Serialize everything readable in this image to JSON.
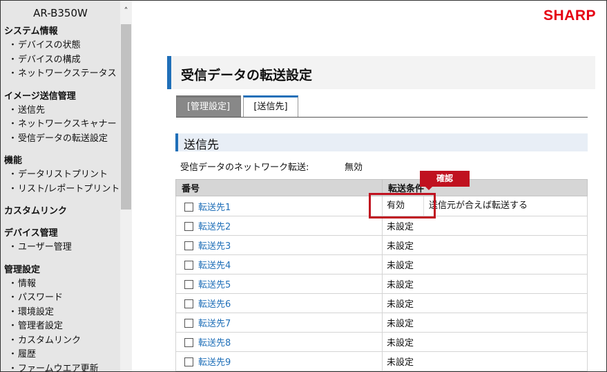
{
  "sidebar": {
    "device_name": "AR-B350W",
    "groups": [
      {
        "heading": "システム情報",
        "items": [
          "デバイスの状態",
          "デバイスの構成",
          "ネットワークステータス"
        ]
      },
      {
        "heading": "イメージ送信管理",
        "items": [
          "送信先",
          "ネットワークスキャナー",
          "受信データの転送設定"
        ]
      },
      {
        "heading": "機能",
        "items": [
          "データリストプリント",
          "リスト/レポートプリント"
        ]
      },
      {
        "heading": "カスタムリンク",
        "items": []
      },
      {
        "heading": "デバイス管理",
        "items": [
          "ユーザー管理"
        ]
      },
      {
        "heading": "管理設定",
        "items": [
          "情報",
          "パスワード",
          "環境設定",
          "管理者設定",
          "カスタムリンク",
          "履歴",
          "ファームウエア更新"
        ]
      }
    ],
    "bullet": "・"
  },
  "header": {
    "logo": "SHARP",
    "page_title": "受信データの転送設定",
    "brand_color": "#e60012",
    "accent_color": "#1f6fb8"
  },
  "tabs": [
    {
      "label": "[管理設定]",
      "active": true
    },
    {
      "label": "[送信先]",
      "active": false
    }
  ],
  "section": {
    "title": "送信先",
    "network_forward_label": "受信データのネットワーク転送:",
    "network_forward_value": "無効"
  },
  "table": {
    "headers": [
      "番号",
      "転送条件"
    ],
    "rows": [
      {
        "name": "転送先1",
        "condition": "有効",
        "detail": "送信元が合えば転送する"
      },
      {
        "name": "転送先2",
        "condition": "未設定"
      },
      {
        "name": "転送先3",
        "condition": "未設定"
      },
      {
        "name": "転送先4",
        "condition": "未設定"
      },
      {
        "name": "転送先5",
        "condition": "未設定"
      },
      {
        "name": "転送先6",
        "condition": "未設定"
      },
      {
        "name": "転送先7",
        "condition": "未設定"
      },
      {
        "name": "転送先8",
        "condition": "未設定"
      },
      {
        "name": "転送先9",
        "condition": "未設定"
      }
    ]
  },
  "annotation": {
    "label": "確認",
    "color": "#c0111f"
  }
}
